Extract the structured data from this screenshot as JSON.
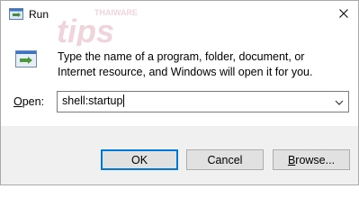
{
  "window": {
    "title": "Run"
  },
  "icons": {
    "title": "run-app-icon",
    "close": "close-icon",
    "body": "run-icon",
    "dropdown": "chevron-down-icon"
  },
  "watermark": {
    "brand": "THAIWARE",
    "word": "tips"
  },
  "dialog": {
    "description": "Type the name of a program, folder, document, or Internet resource, and Windows will open it for you.",
    "open_label_first": "O",
    "open_label_rest": "pen:",
    "open_value": "shell:startup"
  },
  "buttons": {
    "ok": "OK",
    "cancel": "Cancel",
    "browse_first": "B",
    "browse_rest": "rowse..."
  },
  "colors": {
    "accent": "#0078d7",
    "footer": "#f0f0f0",
    "button": "#e1e1e1"
  }
}
